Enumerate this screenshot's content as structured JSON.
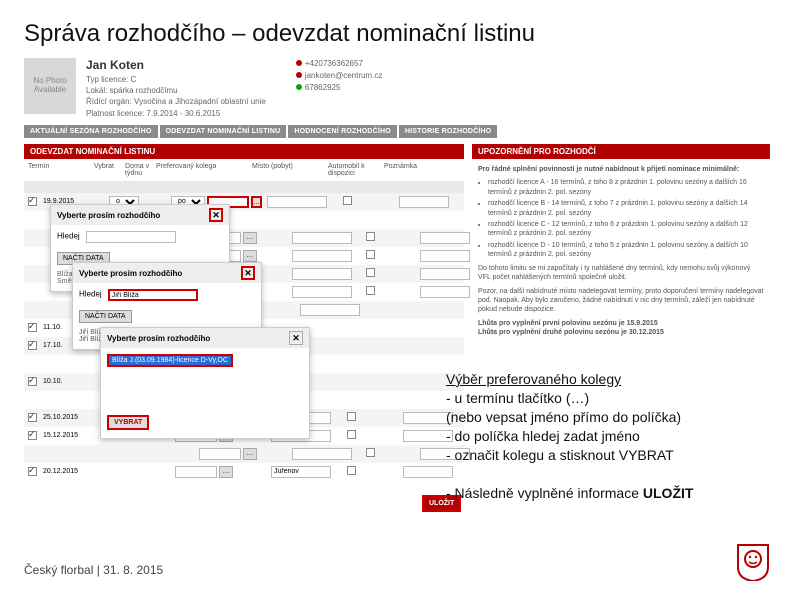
{
  "page": {
    "title": "Správa rozhodčího – odevzdat nominační listinu"
  },
  "profile": {
    "name": "Jan Koten",
    "no_photo": "No Photo Available",
    "line1": "Typ licence: C",
    "line2": "Lokál: spárka rozhodčímu",
    "line3": "Řídící orgán: Vysočina a Jihozápadní oblastní unie",
    "line4": "Platnost licence: 7.9.2014 - 30.6.2015",
    "contact1": "+420736362657",
    "contact2": "jankoten@centrum.cz",
    "contact3": "67862925"
  },
  "tabs": {
    "t1": "AKTUÁLNÍ SEZÓNA ROZHODČÍHO",
    "t2": "ODEVZDAT NOMINAČNÍ LISTINU",
    "t3": "HODNOCENÍ ROZHODČÍHO",
    "t4": "HISTORIE ROZHODČÍHO"
  },
  "section": {
    "left": "ODEVZDAT NOMINAČNÍ LISTINU",
    "right": "UPOZORNĚNÍ PRO ROZHODČÍ"
  },
  "thead": {
    "term": "Termín",
    "vybrat": "Vybrat",
    "doma": "Doma v týdnu",
    "pk": "Preferovaný kolega",
    "misto": "Místo (pobyt)",
    "auto": "Automobil k dispozici",
    "pozn": "Poznámka"
  },
  "rows": [
    {
      "term": "19.9.2015",
      "v": "osoba",
      "pk": "poblíž",
      "m": ""
    },
    {
      "term": "",
      "m": ""
    },
    {
      "term": "",
      "m": ""
    },
    {
      "term": "11.10.",
      "m": ""
    },
    {
      "term": "17.10.",
      "m": ""
    },
    {
      "term": "",
      "m": ""
    },
    {
      "term": "10.10.",
      "m": ""
    },
    {
      "term": "25.10.2015",
      "m": ""
    },
    {
      "term": "15.12.2015",
      "m": ""
    },
    {
      "term": "",
      "m": ""
    },
    {
      "term": "20.12.2015",
      "m": "Juřenov"
    }
  ],
  "overlay1": {
    "title": "Vyberte prosím rozhodčího",
    "hledej": "Hledej",
    "btn": "NAČTI DATA",
    "line1": "Blíža Jiří (26.5.1965) - licence D - E5510",
    "line2": "Směrovat zde"
  },
  "overlay2": {
    "title": "Vyberte prosím rozhodčího",
    "hledej": "Hledej",
    "hval": "Jiří Blíža",
    "btn": "NAČTI DATA",
    "l1": "Jiří Blíža (4.9.29.1954) - licence D - Vy,OC",
    "l2": "Jiří Blíža (4.9.1986) - licence D - Vy,OC"
  },
  "overlay3": {
    "title": "Vyberte prosím rozhodčího",
    "sel": "Blíža J.(03.09.1984)-licence D-Vy,OC",
    "btn": "VYBRAT"
  },
  "right_panel": {
    "intro": "Pro řádné splnění povinností je nutné nabídnout k přijetí nominace minimálně:",
    "b1": "rozhodčí licence A - 16 termínů, z toho 8 z prázdnin 1. polovinu sezóny a dalších 16 termínů z prázdnin 2. pol. sezóny",
    "b2": "rozhodčí licence B - 14 termínů, z toho 7 z prázdnin 1. polovinu sezóny a dalších 14 termínů z prázdnin 2. pol. sezóny",
    "b3": "rozhodčí licence C - 12 termínů, z toho 6 z prázdnin 1. polovinu sezóny a dalších 12 termínů z prázdnin 2. pol. sezóny",
    "b4": "rozhodčí licence D - 10 termínů, z toho 5 z prázdnin 1. polovinu sezóny a dalších 10 termínů z prázdnin 2. pol. sezóny",
    "p2": "Do tohoto limitu se mi započítaly i ty nahlášené dny termínů, kdy nemohu svůj výkonový VFL počet nahlášených termínů společně uložit.",
    "p3": "Pozor, na další nabídnuté místo nadelegovat termíny, proto doporučení termíny nadelegovat pod. Naopak. Aby bylo zaručeno, žádné nabídnutí v nic dny termínů, záleží jen nabídnuté pokud nebude dispozice.",
    "p4": "Lhůta pro vyplnění první polovinu sezónu je 15.9.2015",
    "p5": "Lhůta pro vyplnění druhé polovinu sezónu je 30.12.2015"
  },
  "instructions": {
    "h": "Výběr preferovaného kolegy",
    "l1": "- u termínu tlačítko (…)",
    "l2": "   (nebo vepsat jméno přímo do políčka)",
    "l3": "- do políčka hledej zadat jméno",
    "l4": "- označit kolegu a stisknout VYBRAT",
    "l5": "- Následně vyplněné informace ULOŽIT"
  },
  "save": "ULOŽIT",
  "footer": {
    "text": "Český florbal | 31. 8. 2015"
  }
}
